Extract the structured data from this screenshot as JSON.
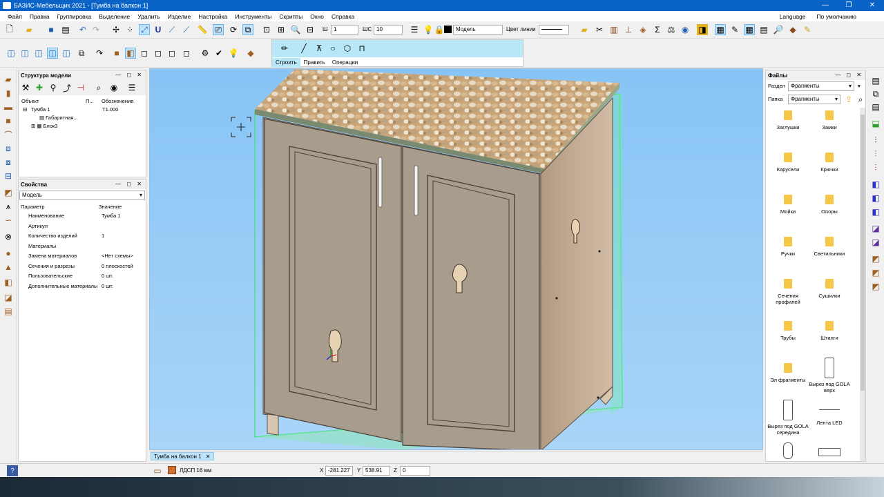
{
  "window": {
    "title": "БАЗИС-Мебельщик 2021 - [Тумба на балкон 1]",
    "controls": [
      "—",
      "❐",
      "✕"
    ]
  },
  "menu": {
    "items": [
      "Файл",
      "Правка",
      "Группировка",
      "Выделение",
      "Удалить",
      "Изделие",
      "Настройка",
      "Инструменты",
      "Скрипты",
      "Окно",
      "Справка"
    ],
    "language": "Language",
    "default": "По умолчанию"
  },
  "toolbar": {
    "width_label": "Ш",
    "width_value": "1",
    "step_label": "ШС",
    "step_value": "10",
    "layer_value": "Модель",
    "line_color_label": "Цвет линии"
  },
  "build_panel": {
    "tabs": [
      "Строить",
      "Править",
      "Операции"
    ]
  },
  "model_tree": {
    "title": "Структура модели",
    "col_object": "Объект",
    "col_p": "П...",
    "col_designation": "Обозначение",
    "nodes": [
      {
        "name": "Тумба 1",
        "designation": "Т1.000"
      },
      {
        "name": "Габаритная..."
      },
      {
        "name": "Блок3"
      }
    ]
  },
  "properties": {
    "title": "Свойства",
    "selector": "Модель",
    "col_param": "Параметр",
    "col_value": "Значение",
    "rows": [
      {
        "param": "Наименование",
        "value": "Тумба 1"
      },
      {
        "param": "Артикул",
        "value": ""
      },
      {
        "param": "Количество изделий",
        "value": "1"
      },
      {
        "param": "Материалы",
        "value": ""
      },
      {
        "param": "Замена материалов",
        "value": "<Нет схемы>"
      },
      {
        "param": "Сечения и разрезы",
        "value": "0 плоскостей"
      },
      {
        "param": "Пользовательские",
        "value": "0 шт."
      },
      {
        "param": "Дополнительные материалы",
        "value": "0 шт."
      }
    ]
  },
  "document_tab": "Тумба на балкон 1",
  "files": {
    "title": "Файлы",
    "section_label": "Раздел",
    "section_value": "Фрагменты",
    "folder_label": "Папка",
    "folder_value": "Фрагменты",
    "items": [
      "Заглушки",
      "Замки",
      "Карусели",
      "Крючки",
      "Мойки",
      "Опоры",
      "Ручки",
      "Светильники",
      "Сечения профилей",
      "Сушилки",
      "Трубы",
      "Штанги",
      "Эл фрагменты",
      "Вырез под GOLA верх",
      "Вырез под GOLA середина",
      "Лента LED"
    ]
  },
  "status": {
    "material": "ЛДСП 16 мм",
    "x_label": "X",
    "x_value": "-281.227",
    "y_label": "Y",
    "y_value": "538.91",
    "z_label": "Z",
    "z_value": "0"
  },
  "colors": {
    "accent": "#0a64c8",
    "viewport": "#9fd0f6",
    "body_panel": "#a89c8c",
    "bbox": "#4de18a",
    "folder": "#f6c84a"
  }
}
